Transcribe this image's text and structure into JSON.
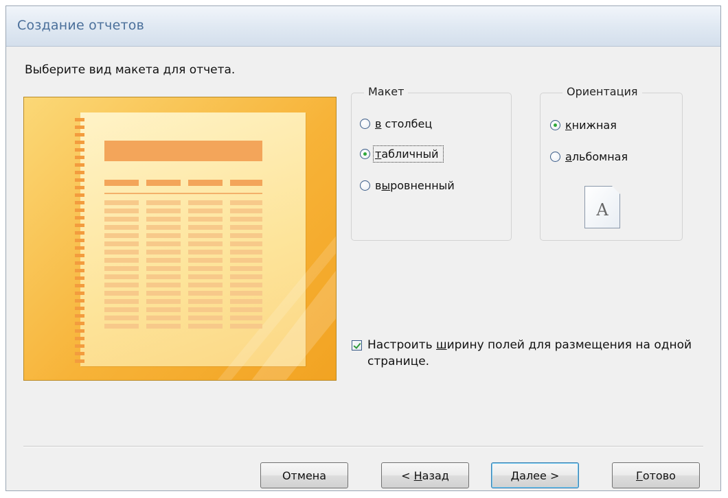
{
  "window": {
    "title": "Создание отчетов"
  },
  "instruction": "Выберите вид макета для отчета.",
  "layout_group": {
    "legend": "Макет",
    "options": [
      {
        "mnemonic": "в",
        "rest": " столбец",
        "checked": false
      },
      {
        "mnemonic": "т",
        "rest": "абличный",
        "checked": true
      },
      {
        "pre": "в",
        "mnemonic": "ы",
        "rest": "ровненный",
        "checked": false
      }
    ]
  },
  "orientation_group": {
    "legend": "Ориентация",
    "options": [
      {
        "mnemonic": "к",
        "rest": "нижная",
        "checked": true
      },
      {
        "mnemonic": "а",
        "rest": "льбомная",
        "checked": false
      }
    ],
    "page_icon_letter": "A"
  },
  "fit_checkbox": {
    "pre": "Настроить ",
    "mnemonic": "ш",
    "rest": "ирину полей для размещения на одной странице.",
    "checked": true
  },
  "buttons": {
    "cancel": "Отмена",
    "back": {
      "pre": "< ",
      "mnemonic": "Н",
      "rest": "азад"
    },
    "next": {
      "mnemonic": "Д",
      "rest": "алее >"
    },
    "finish": {
      "mnemonic": "Г",
      "rest": "отово"
    }
  },
  "colors": {
    "title_text": "#4a6f9a",
    "preview_bg": "#f7b338",
    "preview_accent": "#f3a55a",
    "radio_dot": "#2fa83a",
    "default_button_border": "#3c7fb1"
  }
}
